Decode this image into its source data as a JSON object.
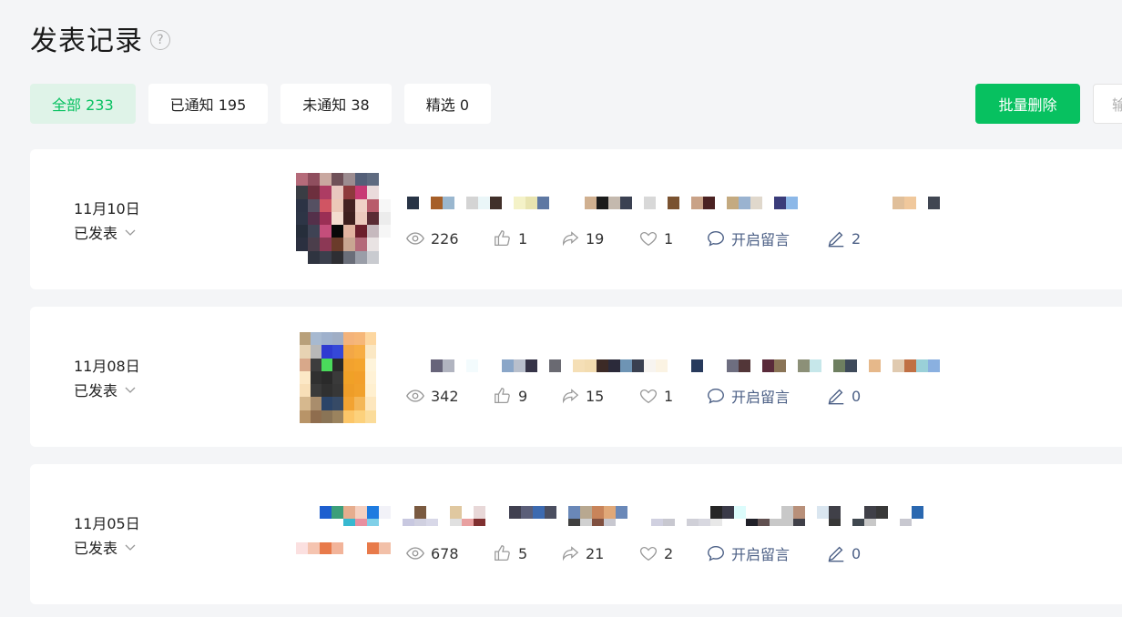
{
  "header": {
    "title": "发表记录",
    "help_icon": "question-icon"
  },
  "filters": [
    {
      "label": "全部 233",
      "active": true
    },
    {
      "label": "已通知 195",
      "active": false
    },
    {
      "label": "未通知 38",
      "active": false
    },
    {
      "label": "精选 0",
      "active": false
    }
  ],
  "toolbar": {
    "batch_delete_label": "批量删除",
    "search_placeholder": "输"
  },
  "colors": {
    "accent": "#07c160",
    "accent_bg": "#dff3e8",
    "link": "#4b5f85"
  },
  "posts": [
    {
      "date": "11月10日",
      "status": "已发表",
      "views": "226",
      "likes": "1",
      "shares": "19",
      "wows": "1",
      "comment_label": "开启留言",
      "edits": "2"
    },
    {
      "date": "11月08日",
      "status": "已发表",
      "views": "342",
      "likes": "9",
      "shares": "15",
      "wows": "1",
      "comment_label": "开启留言",
      "edits": "0"
    },
    {
      "date": "11月05日",
      "status": "已发表",
      "views": "678",
      "likes": "5",
      "shares": "21",
      "wows": "2",
      "comment_label": "开启留言",
      "edits": "0"
    }
  ],
  "icons": {
    "views": "eye-icon",
    "likes": "thumbs-up-icon",
    "shares": "share-arrow-icon",
    "wows": "heart-icon",
    "comment": "comment-bubble-icon",
    "edit": "pencil-icon",
    "status": "chevron-down-icon"
  }
}
